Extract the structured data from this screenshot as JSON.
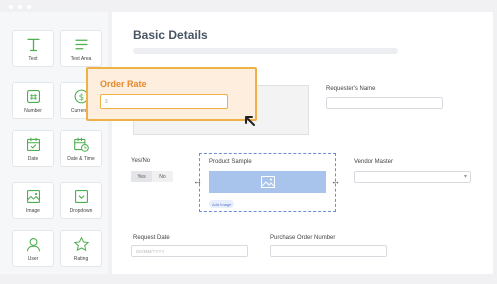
{
  "palette": {
    "items": [
      {
        "label": "Text",
        "icon": "text-icon"
      },
      {
        "label": "Text Area",
        "icon": "text-area-icon"
      },
      {
        "label": "Number",
        "icon": "number-icon"
      },
      {
        "label": "Currency",
        "icon": "currency-icon"
      },
      {
        "label": "Date",
        "icon": "date-icon"
      },
      {
        "label": "Date & Time",
        "icon": "date-time-icon"
      },
      {
        "label": "Image",
        "icon": "image-icon"
      },
      {
        "label": "Dropdown",
        "icon": "dropdown-icon"
      },
      {
        "label": "User",
        "icon": "user-icon"
      },
      {
        "label": "Rating",
        "icon": "rating-icon"
      }
    ]
  },
  "form": {
    "title": "Basic Details",
    "requester_label": "Requester's Name",
    "yesno_label": "Yes/No",
    "yes": "Yes",
    "no": "No",
    "product_sample_label": "Product Sample",
    "add_image": "Add Image",
    "vendor_master_label": "Vendor Master",
    "request_date_label": "Request Date",
    "request_date_placeholder": "DD/MM/YYYY",
    "po_number_label": "Purchase Order Number"
  },
  "drag_card": {
    "title": "Order Rate",
    "placeholder": "$"
  },
  "colors": {
    "accent_green": "#4caf50",
    "drag_orange": "#e4892e",
    "selection_blue": "#6b8fd6"
  }
}
